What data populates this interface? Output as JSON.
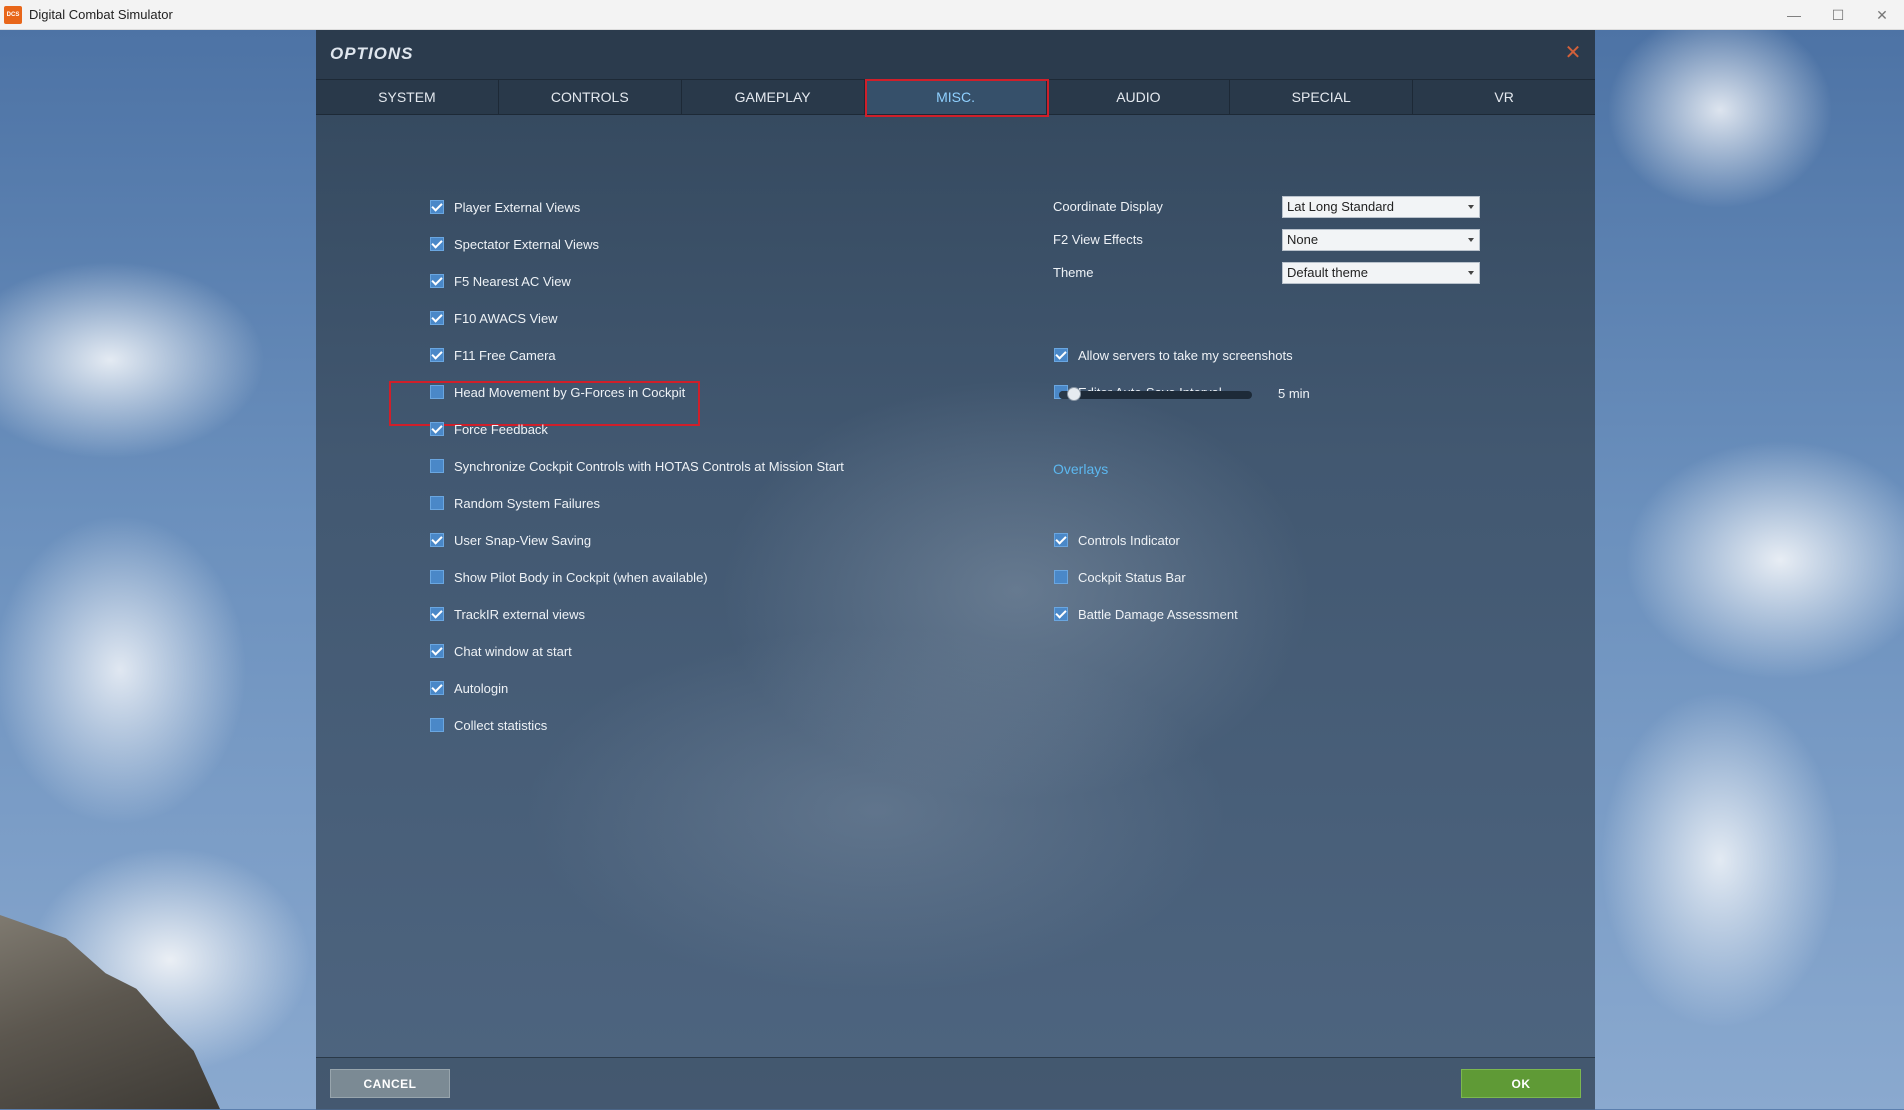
{
  "window": {
    "title": "Digital Combat Simulator",
    "icon_label": "DCS",
    "controls": [
      "minimize-icon",
      "maximize-icon",
      "close-icon"
    ]
  },
  "dialog": {
    "title": "OPTIONS",
    "close_icon": "close-icon",
    "active_tab": "MISC."
  },
  "tabs": [
    {
      "label": "SYSTEM"
    },
    {
      "label": "CONTROLS"
    },
    {
      "label": "GAMEPLAY"
    },
    {
      "label": "MISC."
    },
    {
      "label": "AUDIO"
    },
    {
      "label": "SPECIAL"
    },
    {
      "label": "VR"
    }
  ],
  "left_options": [
    {
      "label": "Player External Views",
      "checked": true
    },
    {
      "label": "Spectator External Views",
      "checked": true
    },
    {
      "label": "F5 Nearest AC View",
      "checked": true
    },
    {
      "label": "F10 AWACS View",
      "checked": true
    },
    {
      "label": "F11 Free Camera",
      "checked": true
    },
    {
      "label": "Head Movement by G-Forces in Cockpit",
      "checked": false
    },
    {
      "label": "Force Feedback",
      "checked": true,
      "highlighted": true
    },
    {
      "label": "Synchronize Cockpit Controls with HOTAS Controls at Mission Start",
      "checked": false
    },
    {
      "label": "Random System Failures",
      "checked": false
    },
    {
      "label": "User Snap-View Saving",
      "checked": true
    },
    {
      "label": "Show Pilot Body in Cockpit (when available)",
      "checked": false
    },
    {
      "label": "TrackIR external views",
      "checked": true
    },
    {
      "label": "Chat window at start",
      "checked": true
    },
    {
      "label": "Autologin",
      "checked": true
    },
    {
      "label": "Collect statistics",
      "checked": false
    }
  ],
  "selects": {
    "coordinate_display": {
      "label": "Coordinate Display",
      "value": "Lat Long Standard"
    },
    "f2_view_effects": {
      "label": "F2 View Effects",
      "value": "None"
    },
    "theme": {
      "label": "Theme",
      "value": "Default theme"
    }
  },
  "right_options": {
    "allow_screenshots": {
      "label": "Allow servers to take my screenshots",
      "checked": true
    },
    "editor_autosave": {
      "label": "Editor Auto-Save Interval",
      "checked": false
    }
  },
  "autosave_slider": {
    "value_text": "5 min",
    "level": 0.08
  },
  "overlays": {
    "heading": "Overlays",
    "items": [
      {
        "label": "Controls Indicator",
        "checked": true
      },
      {
        "label": "Cockpit Status Bar",
        "checked": false
      },
      {
        "label": "Battle Damage Assessment",
        "checked": true
      }
    ]
  },
  "footer": {
    "cancel_label": "CANCEL",
    "ok_label": "OK"
  },
  "colors": {
    "accent": "#5cb8f0",
    "highlight": "#d01f2a",
    "ok_green": "#5f9a36"
  }
}
